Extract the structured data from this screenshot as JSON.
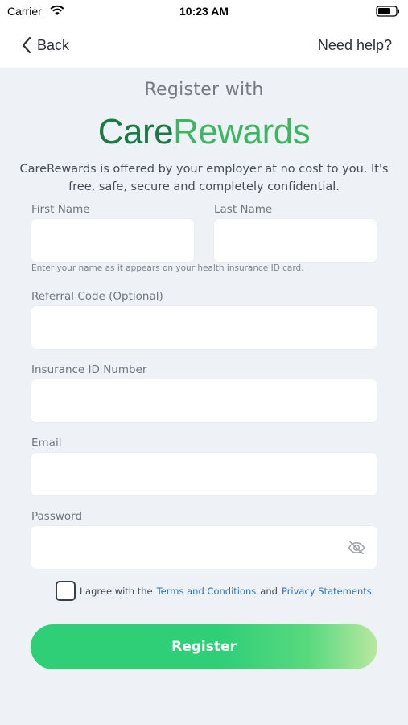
{
  "status_bar": {
    "carrier": "Carrier",
    "time": "10:23 AM"
  },
  "nav": {
    "back_label": "Back",
    "help_label": "Need help?"
  },
  "header": {
    "title": "Register with",
    "logo_part1": "Care",
    "logo_part2": "Rewards",
    "intro": "CareRewards is offered by your employer at no cost to you. It's free, safe, secure and completely confidential."
  },
  "form": {
    "first_name": {
      "label": "First Name",
      "value": ""
    },
    "last_name": {
      "label": "Last Name",
      "value": ""
    },
    "name_hint": "Enter your name as it appears on your health insurance ID card.",
    "referral": {
      "label": "Referral Code (Optional)",
      "value": ""
    },
    "insurance_id": {
      "label": "Insurance ID Number",
      "value": ""
    },
    "email": {
      "label": "Email",
      "value": ""
    },
    "password": {
      "label": "Password",
      "value": ""
    },
    "agree": {
      "prefix": "I agree with the",
      "terms_link": "Terms and Conditions",
      "and": "and",
      "privacy_link": "Privacy Statements",
      "checked": false
    },
    "submit_label": "Register"
  },
  "colors": {
    "logo_dark": "#1a7a44",
    "logo_light": "#3cb760",
    "link": "#2d6fb8",
    "button": "#2fcf78",
    "background": "#eef2f7"
  },
  "icons": {
    "wifi": "wifi-icon",
    "battery": "battery-icon",
    "back": "chevron-left-icon",
    "password_toggle": "eye-off-icon"
  }
}
